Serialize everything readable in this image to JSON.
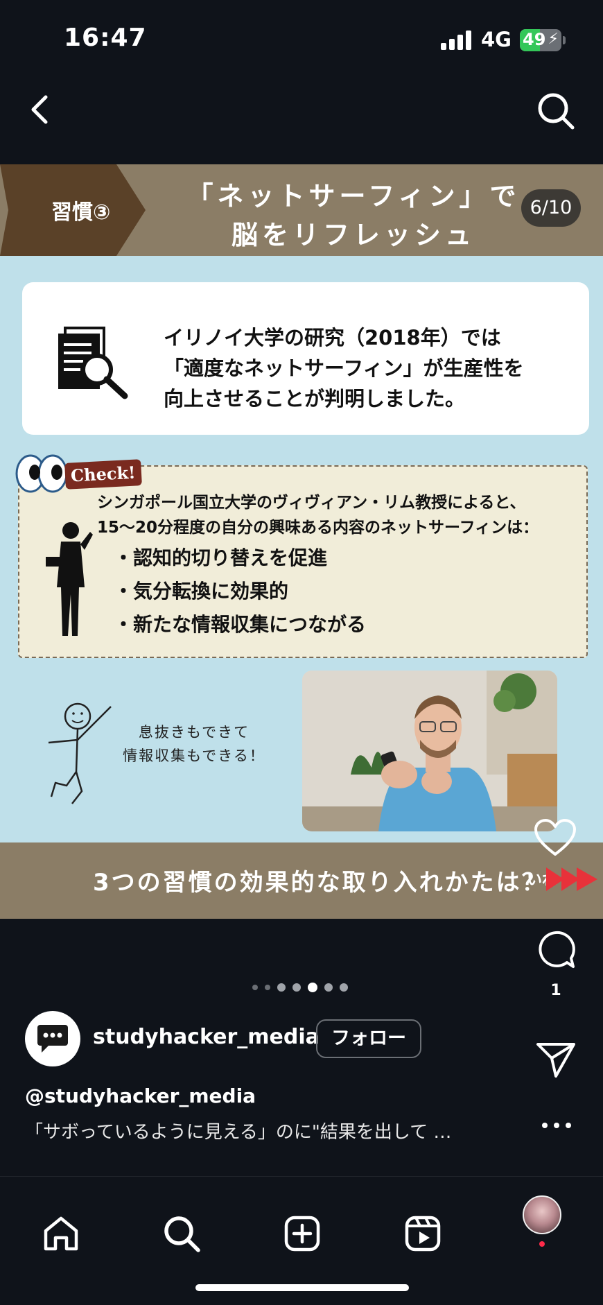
{
  "status_bar": {
    "time": "16:47",
    "network": "4G",
    "battery_label": "49",
    "battery_level": 0.49
  },
  "top_nav": {
    "back_icon": "chevron-left-icon",
    "search_icon": "search-icon"
  },
  "post": {
    "tag": "習慣③",
    "title_line1": "「ネットサーフィン」で",
    "title_line2": "脳をリフレッシュ",
    "page_counter": "6/10",
    "research_lines": [
      "イリノイ大学の研究（2018年）では",
      "「適度なネットサーフィン」が生産性を",
      "向上させることが判明しました。"
    ],
    "check_badge": "Check!",
    "check_intro_lines": [
      "シンガポール国立大学のヴィヴィアン・リム教授によると、",
      "15〜20分程度の自分の興味ある内容のネットサーフィンは："
    ],
    "check_points": [
      "・認知的切り替えを促進",
      "・気分転換に効果的",
      "・新たな情報収集につながる"
    ],
    "stick_caption_lines": [
      "息抜きもできて",
      "情報収集もできる！"
    ],
    "bottom_banner": "3つの習慣の効果的な取り入れかたは？",
    "bottom_badge": "いね"
  },
  "actions": {
    "like_icon": "heart-icon",
    "comment_icon": "comment-icon",
    "comment_count": "1",
    "share_icon": "paper-plane-icon",
    "more_icon": "more-horizontal-icon"
  },
  "carousel": {
    "total_dots": 7,
    "active_index": 4
  },
  "account": {
    "username": "studyhacker_media",
    "follow_label": "フォロー"
  },
  "caption": {
    "user": "@studyhacker_media",
    "text": "「サボっているように見える」のに\"結果を出して …"
  },
  "tab_bar": {
    "items": [
      "home-icon",
      "search-icon",
      "create-icon",
      "reels-icon",
      "profile-avatar"
    ]
  },
  "colors": {
    "background": "#0f131a",
    "slide_bg": "#bfe0ea",
    "band": "#8b7d66",
    "tag": "#5a4128",
    "check_bg": "#f1edd9",
    "notification_dot": "#ff2b4a",
    "battery_green": "#34c759"
  }
}
